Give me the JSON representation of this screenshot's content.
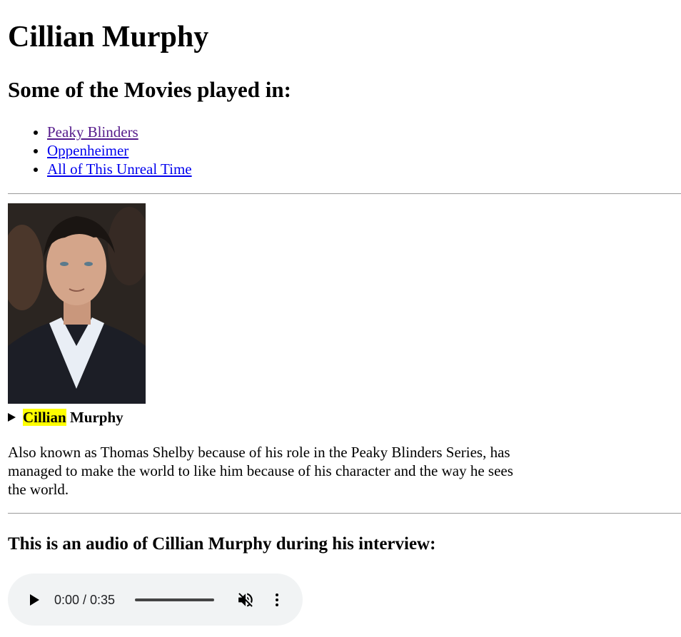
{
  "page": {
    "title": "Cillian Murphy",
    "movies_heading": "Some of the Movies played in:",
    "movies": [
      {
        "label": "Peaky Blinders",
        "visited": true
      },
      {
        "label": "Oppenheimer",
        "visited": false
      },
      {
        "label": "All of This Unreal Time",
        "visited": false
      }
    ],
    "details": {
      "summary_highlight": "Cillian",
      "summary_rest": " Murphy"
    },
    "bio": "Also known as Thomas Shelby because of his role in the Peaky Blinders Series, has managed to make the world to like him because of his character and the way he sees the world.",
    "audio_heading": "This is an audio of Cillian Murphy during his interview:",
    "audio": {
      "time_display": "0:00 / 0:35",
      "muted": true
    }
  },
  "colors": {
    "link": "#0000ee",
    "visited_link": "#551a8b",
    "highlight": "#ffff00",
    "player_bg": "#f1f3f4"
  },
  "icons": {
    "disclosure": "triangle-right-icon",
    "play": "play-icon",
    "mute": "volume-muted-icon",
    "more": "more-vertical-icon"
  }
}
